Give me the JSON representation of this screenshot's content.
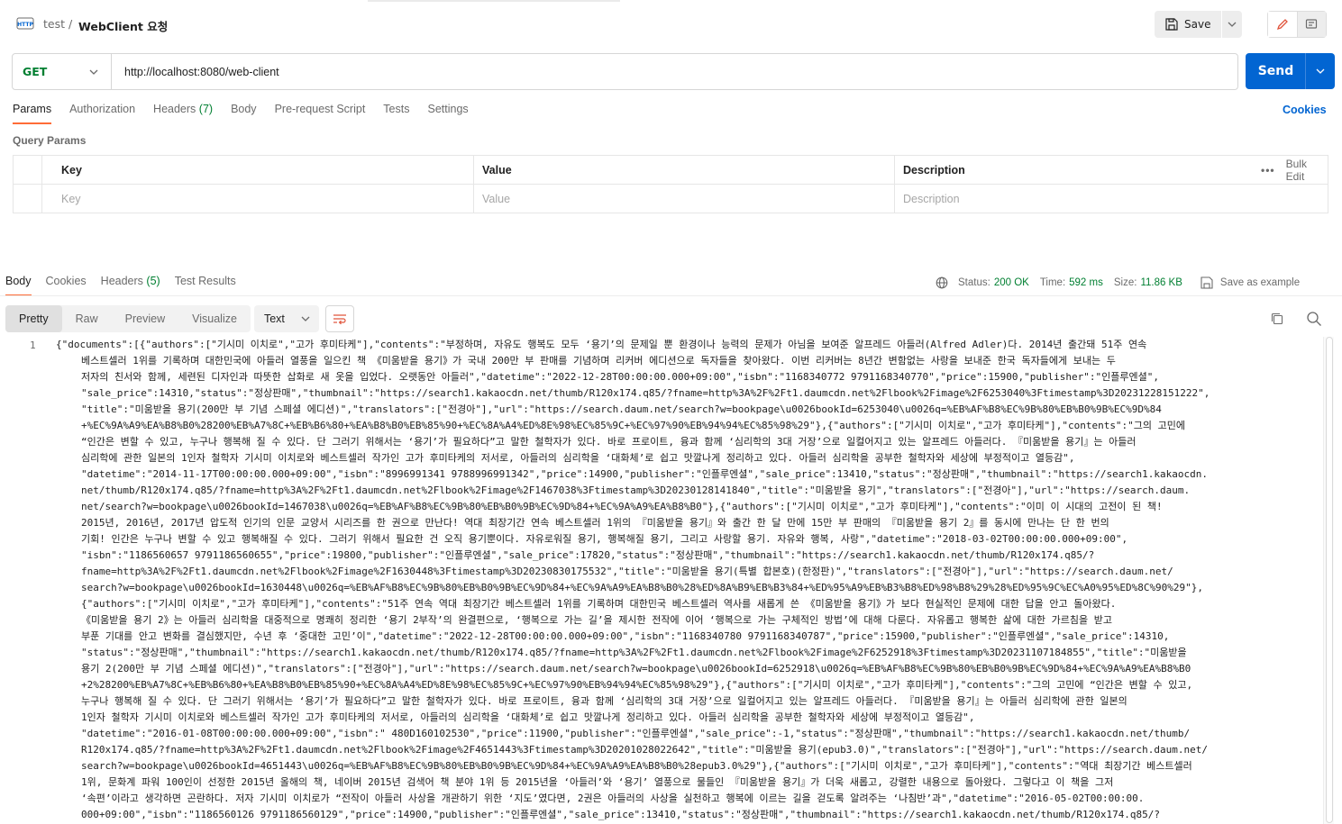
{
  "breadcrumb": {
    "parent": "test",
    "separator": "/",
    "current": "WebClient 요청"
  },
  "toolbar": {
    "save_label": "Save"
  },
  "request": {
    "method": "GET",
    "url": "http://localhost:8080/web-client",
    "send_label": "Send"
  },
  "request_tabs": [
    {
      "label": "Params",
      "count": ""
    },
    {
      "label": "Authorization",
      "count": ""
    },
    {
      "label": "Headers",
      "count": "(7)"
    },
    {
      "label": "Body",
      "count": ""
    },
    {
      "label": "Pre-request Script",
      "count": ""
    },
    {
      "label": "Tests",
      "count": ""
    },
    {
      "label": "Settings",
      "count": ""
    }
  ],
  "cookies_link": "Cookies",
  "query_params": {
    "title": "Query Params",
    "headers": [
      "Key",
      "Value",
      "Description"
    ],
    "placeholders": [
      "Key",
      "Value",
      "Description"
    ],
    "bulk_edit": "Bulk Edit",
    "more": "•••"
  },
  "response_tabs": [
    {
      "label": "Body",
      "count": ""
    },
    {
      "label": "Cookies",
      "count": ""
    },
    {
      "label": "Headers",
      "count": "(5)"
    },
    {
      "label": "Test Results",
      "count": ""
    }
  ],
  "response_status": {
    "status_label": "Status:",
    "status_value": "200 OK",
    "time_label": "Time:",
    "time_value": "592 ms",
    "size_label": "Size:",
    "size_value": "11.86 KB",
    "save_example": "Save as example"
  },
  "format": {
    "options": [
      "Pretty",
      "Raw",
      "Preview",
      "Visualize"
    ],
    "active": "Pretty",
    "language": "Text"
  },
  "code": {
    "line_number": "1",
    "lines": [
      "{\"documents\":[{\"authors\":[\"기시미 이치로\",\"고가 후미타케\"],\"contents\":\"부정하며, 자유도 행복도 모두 ‘용기’의 문제일 뿐 환경이나 능력의 문제가 아님을 보여준 알프레드 아들러(Alfred Adler)다. 2014년 출간돼 51주 연속",
      "베스트셀러 1위를 기록하며 대한민국에 아들러 열풍을 일으킨 책 《미움받을 용기》가 국내 200만 부 판매를 기념하며 리커버 에디션으로 독자들을 찾아왔다. 이번 리커버는 8년간 변함없는 사랑을 보내준 한국 독자들에게 보내는 두",
      "저자의 친서와 함께, 세련된 디자인과 따뜻한 삽화로 새 옷을 입었다. 오랫동안 아들러\",\"datetime\":\"2022-12-28T00:00:00.000+09:00\",\"isbn\":\"1168340772 9791168340770\",\"price\":15900,\"publisher\":\"인플루엔셜\",",
      "\"sale_price\":14310,\"status\":\"정상판매\",\"thumbnail\":\"https://search1.kakaocdn.net/thumb/R120x174.q85/?fname=http%3A%2F%2Ft1.daumcdn.net%2Flbook%2Fimage%2F6253040%3Ftimestamp%3D20231228151222\",",
      "\"title\":\"미움받을 용기(200만 부 기념 스페셜 에디션)\",\"translators\":[\"전경아\"],\"url\":\"https://search.daum.net/search?w=bookpage\\u0026bookId=6253040\\u0026q=%EB%AF%B8%EC%9B%80%EB%B0%9B%EC%9D%84",
      "+%EC%9A%A9%EA%B8%B0%28200%EB%A7%8C+%EB%B6%80+%EA%B8%B0%EB%85%90+%EC%8A%A4%ED%8E%98%EC%85%9C+%EC%97%90%EB%94%94%EC%85%98%29\"},{\"authors\":[\"기시미 이치로\",\"고가 후미타케\"],\"contents\":\"그의 고민에",
      "“인간은 변할 수 있고, 누구나 행복해 질 수 있다. 단 그러기 위해서는 ‘용기’가 필요하다”고 말한 철학자가 있다. 바로 프로이트, 융과 함께 ‘심리학의 3대 거장’으로 일컬어지고 있는 알프레드 아들러다.  『미움받을 용기』는 아들러",
      "심리학에 관한 일본의 1인자 철학자 기시미 이치로와 베스트셀러 작가인 고가 후미타케의 저서로, 아들러의 심리학을 ‘대화체’로 쉽고 맛깔나게 정리하고 있다. 아들러 심리학을 공부한 철학자와 세상에 부정적이고 열등감\",",
      "\"datetime\":\"2014-11-17T00:00:00.000+09:00\",\"isbn\":\"8996991341 9788996991342\",\"price\":14900,\"publisher\":\"인플루엔셜\",\"sale_price\":13410,\"status\":\"정상판매\",\"thumbnail\":\"https://search1.kakaocdn.",
      "net/thumb/R120x174.q85/?fname=http%3A%2F%2Ft1.daumcdn.net%2Flbook%2Fimage%2F1467038%3Ftimestamp%3D20230128141840\",\"title\":\"미움받을 용기\",\"translators\":[\"전경아\"],\"url\":\"https://search.daum.",
      "net/search?w=bookpage\\u0026bookId=1467038\\u0026q=%EB%AF%B8%EC%9B%80%EB%B0%9B%EC%9D%84+%EC%9A%A9%EA%B8%B0\"},{\"authors\":[\"기시미 이치로\",\"고가 후미타케\"],\"contents\":\"이미 이 시대의 고전이 된 책!",
      "2015년, 2016년, 2017년 압도적 인기의 인문 교양서 시리즈를  한 권으로 만난다!    역대 최장기간 연속 베스트셀러 1위의 『미움받을 용기』와  출간 한 달 만에 15만 부 판매의 『미움받을 용기 2』를  동시에 만나는 단 한 번의",
      "기회!    인간은 누구나 변할 수 있고 행복해질 수 있다. 그러기 위해서 필요한 건 오직 용기뿐이다. 자유로워질 용기, 행복해질 용기, 그리고 사랑할 용기. 자유와 행복, 사랑\",\"datetime\":\"2018-03-02T00:00:00.000+09:00\",",
      "\"isbn\":\"1186560657 9791186560655\",\"price\":19800,\"publisher\":\"인플루엔셜\",\"sale_price\":17820,\"status\":\"정상판매\",\"thumbnail\":\"https://search1.kakaocdn.net/thumb/R120x174.q85/?",
      "fname=http%3A%2F%2Ft1.daumcdn.net%2Flbook%2Fimage%2F1630448%3Ftimestamp%3D20230830175532\",\"title\":\"미움받을 용기(특별 합본호)(한정판)\",\"translators\":[\"전경아\"],\"url\":\"https://search.daum.net/",
      "search?w=bookpage\\u0026bookId=1630448\\u0026q=%EB%AF%B8%EC%9B%80%EB%B0%9B%EC%9D%84+%EC%9A%A9%EA%B8%B0%28%ED%8A%B9%EB%B3%84+%ED%95%A9%EB%B3%B8%ED%98%B8%29%28%ED%95%9C%EC%A0%95%ED%8C%90%29\"},",
      "{\"authors\":[\"기시미 이치로\",\"고가 후미타케\"],\"contents\":\"51주 연속 역대 최장기간 베스트셀러 1위를 기록하며 대한민국 베스트셀러 역사를 새롭게 쓴 《미움받을 용기》가 보다 현실적인 문제에 대한 답을 안고 돌아왔다.",
      "《미움받을 용기 2》는 아들러 심리학을 대중적으로 명쾌히 정리한 ‘용기 2부작’의 완결편으로, ‘행복으로 가는 길’을 제시한 전작에 이어 ‘행복으로 가는 구체적인 방법’에 대해 다룬다.  자유롭고 행복한 삶에 대한 가르침을 받고",
      "부푼 기대를 안고 변화를 결심했지만, 수년 후 ‘중대한 고민’이\",\"datetime\":\"2022-12-28T00:00:00.000+09:00\",\"isbn\":\"1168340780 9791168340787\",\"price\":15900,\"publisher\":\"인플루엔셜\",\"sale_price\":14310,",
      "\"status\":\"정상판매\",\"thumbnail\":\"https://search1.kakaocdn.net/thumb/R120x174.q85/?fname=http%3A%2F%2Ft1.daumcdn.net%2Flbook%2Fimage%2F6252918%3Ftimestamp%3D20231107184855\",\"title\":\"미움받을",
      "용기 2(200만 부 기념 스페셜 에디션)\",\"translators\":[\"전경아\"],\"url\":\"https://search.daum.net/search?w=bookpage\\u0026bookId=6252918\\u0026q=%EB%AF%B8%EC%9B%80%EB%B0%9B%EC%9D%84+%EC%9A%A9%EA%B8%B0",
      "+2%28200%EB%A7%8C+%EB%B6%80+%EA%B8%B0%EB%85%90+%EC%8A%A4%ED%8E%98%EC%85%9C+%EC%97%90%EB%94%94%EC%85%98%29\"},{\"authors\":[\"기시미 이치로\",\"고가 후미타케\"],\"contents\":\"그의 고민에 “인간은 변할 수 있고,",
      "누구나 행복해 질 수 있다. 단 그러기 위해서는 ‘용기’가 필요하다”고 말한 철학자가 있다. 바로 프로이트, 융과 함께 ‘심리학의 3대 거장’으로 일컬어지고 있는 알프레드 아들러다.  『미움받을 용기』는 아들러 심리학에 관한 일본의",
      "1인자 철학자 기시미 이치로와 베스트셀러 작가인 고가 후미타케의 저서로, 아들러의 심리학을 ‘대화체’로 쉽고 맛깔나게 정리하고 있다. 아들러 심리학을 공부한 철학자와 세상에 부정적이고 열등감\",",
      "\"datetime\":\"2016-01-08T00:00:00.000+09:00\",\"isbn\":\" 480D160102530\",\"price\":11900,\"publisher\":\"인플루엔셜\",\"sale_price\":-1,\"status\":\"정상판매\",\"thumbnail\":\"https://search1.kakaocdn.net/thumb/",
      "R120x174.q85/?fname=http%3A%2F%2Ft1.daumcdn.net%2Flbook%2Fimage%2F4651443%3Ftimestamp%3D20201028022642\",\"title\":\"미움받을 용기(epub3.0)\",\"translators\":[\"전경아\"],\"url\":\"https://search.daum.net/",
      "search?w=bookpage\\u0026bookId=4651443\\u0026q=%EB%AF%B8%EC%9B%80%EB%B0%9B%EC%9D%84+%EC%9A%A9%EA%B8%B0%28epub3.0%29\"},{\"authors\":[\"기시미 이치로\",\"고가 후미타케\"],\"contents\":\"역대 최장기간 베스트셀러",
      "1위, 문화계 파워 100인이 선정한 2015년 올해의 책, 네이버 2015년 검색어 책 분야 1위 등 2015년을 ‘아들러’와 ‘용기’ 열풍으로 물들인 『미움받을 용기』가 더욱 새롭고, 강렬한 내용으로 돌아왔다. 그렇다고 이 책을 그저",
      "‘속편’이라고 생각하면 곤란하다. 저자 기시미 이치로가 “전작이 아들러 사상을 개관하기 위한 ‘지도’였다면, 2권은 아들러의 사상을 실천하고 행복에 이르는 길을 걷도록 알려주는 ‘나침반’과\",\"datetime\":\"2016-05-02T00:00:00.",
      "000+09:00\",\"isbn\":\"1186560126 9791186560129\",\"price\":14900,\"publisher\":\"인플루엔셜\",\"sale_price\":13410,\"status\":\"정상판매\",\"thumbnail\":\"https://search1.kakaocdn.net/thumb/R120x174.q85/?"
    ]
  }
}
